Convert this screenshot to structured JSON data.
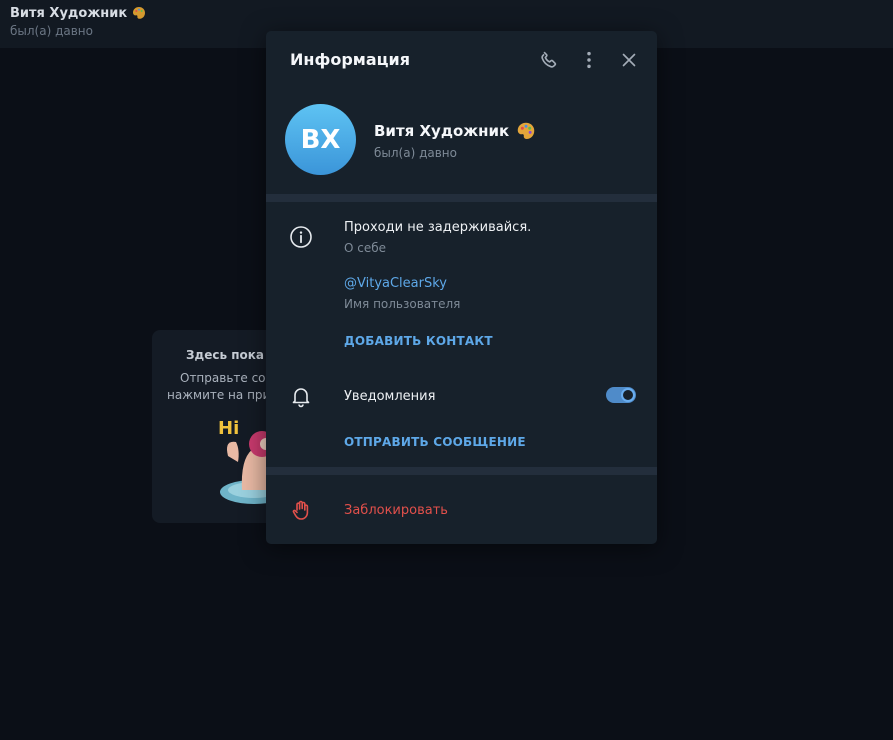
{
  "background_chat": {
    "contact_name": "Витя Художник",
    "status": "был(а) давно",
    "empty_title": "Здесь пока н",
    "empty_line1": "Отправьте со",
    "empty_line2": "нажмите на при"
  },
  "modal": {
    "title": "Информация",
    "header_icons": [
      "phone-icon",
      "more-vertical-icon",
      "close-icon"
    ],
    "profile": {
      "avatar_initials": "ВХ",
      "name": "Витя Художник",
      "name_emoji": "palette-icon",
      "status": "был(а) давно"
    },
    "bio": {
      "text": "Проходи не задерживайся.",
      "label": "О себе"
    },
    "username": {
      "value": "@VityaClearSky",
      "label": "Имя пользователя"
    },
    "add_contact_label": "ДОБАВИТЬ КОНТАКТ",
    "notifications": {
      "label": "Уведомления",
      "enabled": true
    },
    "send_message_label": "ОТПРАВИТЬ СООБЩЕНИЕ",
    "block_label": "Заблокировать"
  },
  "colors": {
    "page_bg": "#0b0f17",
    "modal_bg": "#17212b",
    "divider": "#232e3c",
    "accent": "#5ea8e8",
    "danger": "#e2504b",
    "avatar_top": "#5ec3f3",
    "avatar_bottom": "#3b95d9"
  }
}
